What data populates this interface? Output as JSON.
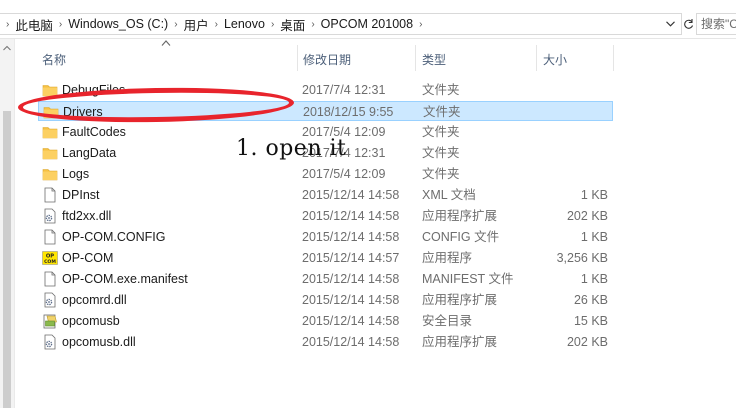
{
  "address_bar": {
    "breadcrumbs": [
      "此电脑",
      "Windows_OS (C:)",
      "用户",
      "Lenovo",
      "桌面",
      "OPCOM 201008"
    ],
    "search_placeholder": "搜索\"C"
  },
  "columns": {
    "name": "名称",
    "date_modified": "修改日期",
    "type": "类型",
    "size": "大小"
  },
  "files": [
    {
      "name": "DebugFiles",
      "date": "2017/7/4 12:31",
      "type": "文件夹",
      "size": "",
      "icon": "folder-icon"
    },
    {
      "name": "Drivers",
      "date": "2018/12/15 9:55",
      "type": "文件夹",
      "size": "",
      "icon": "folder-icon",
      "selected": true
    },
    {
      "name": "FaultCodes",
      "date": "2017/5/4 12:09",
      "type": "文件夹",
      "size": "",
      "icon": "folder-icon"
    },
    {
      "name": "LangData",
      "date": "2017/7/4 12:31",
      "type": "文件夹",
      "size": "",
      "icon": "folder-icon"
    },
    {
      "name": "Logs",
      "date": "2017/5/4 12:09",
      "type": "文件夹",
      "size": "",
      "icon": "folder-icon"
    },
    {
      "name": "DPInst",
      "date": "2015/12/14 14:58",
      "type": "XML 文档",
      "size": "1 KB",
      "icon": "document-icon"
    },
    {
      "name": "ftd2xx.dll",
      "date": "2015/12/14 14:58",
      "type": "应用程序扩展",
      "size": "202 KB",
      "icon": "dll-gear-icon"
    },
    {
      "name": "OP-COM.CONFIG",
      "date": "2015/12/14 14:58",
      "type": "CONFIG 文件",
      "size": "1 KB",
      "icon": "document-icon"
    },
    {
      "name": "OP-COM",
      "date": "2015/12/14 14:57",
      "type": "应用程序",
      "size": "3,256 KB",
      "icon": "opcom-app-icon"
    },
    {
      "name": "OP-COM.exe.manifest",
      "date": "2015/12/14 14:58",
      "type": "MANIFEST 文件",
      "size": "1 KB",
      "icon": "document-icon"
    },
    {
      "name": "opcomrd.dll",
      "date": "2015/12/14 14:58",
      "type": "应用程序扩展",
      "size": "26 KB",
      "icon": "dll-gear-icon"
    },
    {
      "name": "opcomusb",
      "date": "2015/12/14 14:58",
      "type": "安全目录",
      "size": "15 KB",
      "icon": "security-catalog-icon"
    },
    {
      "name": "opcomusb.dll",
      "date": "2015/12/14 14:58",
      "type": "应用程序扩展",
      "size": "202 KB",
      "icon": "dll-gear-icon"
    }
  ],
  "annotation": {
    "text": "1. open it",
    "color": "#e8242c"
  },
  "colors": {
    "selection_bg": "#cce8ff",
    "selection_border": "#99d1ff",
    "header_text": "#4d607a",
    "folder": "#f6c143"
  }
}
